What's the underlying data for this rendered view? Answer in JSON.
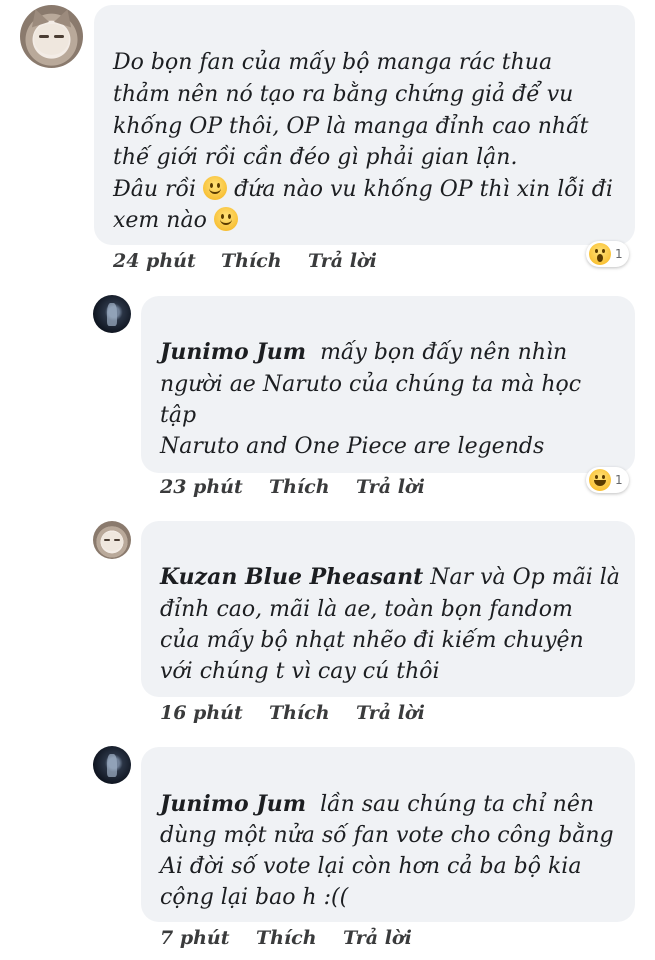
{
  "comments": [
    {
      "author": "",
      "lines": [
        "Do bọn fan của mấy bộ manga rác thua",
        "thảm nên nó tạo ra bằng chứng giả để vu",
        "khống OP thôi, OP là manga đỉnh cao nhất",
        "thế giới rồi cần đéo gì phải gian lận.",
        "Đâu rồi",
        "đứa nào vu khống OP thì xin lỗi đi",
        "xem nào"
      ],
      "time": "24 phút",
      "like": "Thích",
      "reply": "Trả lời",
      "reaction": {
        "icon": "wow-reaction-icon",
        "count": "1"
      }
    },
    {
      "author": "Junimo Jum",
      "lines": [
        "mấy bọn đấy nên nhìn",
        "người ae Naruto của chúng ta mà học",
        "tập",
        "Naruto and One Piece are legends"
      ],
      "time": "23 phút",
      "like": "Thích",
      "reply": "Trả lời",
      "reaction": {
        "icon": "haha-reaction-icon",
        "count": "1"
      }
    },
    {
      "author": "Kuzan Blue Pheasant",
      "lines": [
        "Nar và Op mãi là",
        "đỉnh cao, mãi là ae, toàn bọn fandom",
        "của mấy bộ nhạt nhẽo đi kiếm chuyện",
        "với chúng t vì cay cú thôi"
      ],
      "time": "16 phút",
      "like": "Thích",
      "reply": "Trả lời"
    },
    {
      "author": "Junimo Jum",
      "lines": [
        "lần sau chúng ta chỉ nên",
        "dùng một nửa số fan vote cho công bằng",
        "Ai đời số vote lại còn hơn cả ba bộ kia",
        "cộng lại bao h :(("
      ],
      "time": "7 phút",
      "like": "Thích",
      "reply": "Trả lời"
    }
  ],
  "colors": {
    "bubble": "#f0f2f5",
    "text": "#1c1e21",
    "meta": "#3a3b3c"
  }
}
